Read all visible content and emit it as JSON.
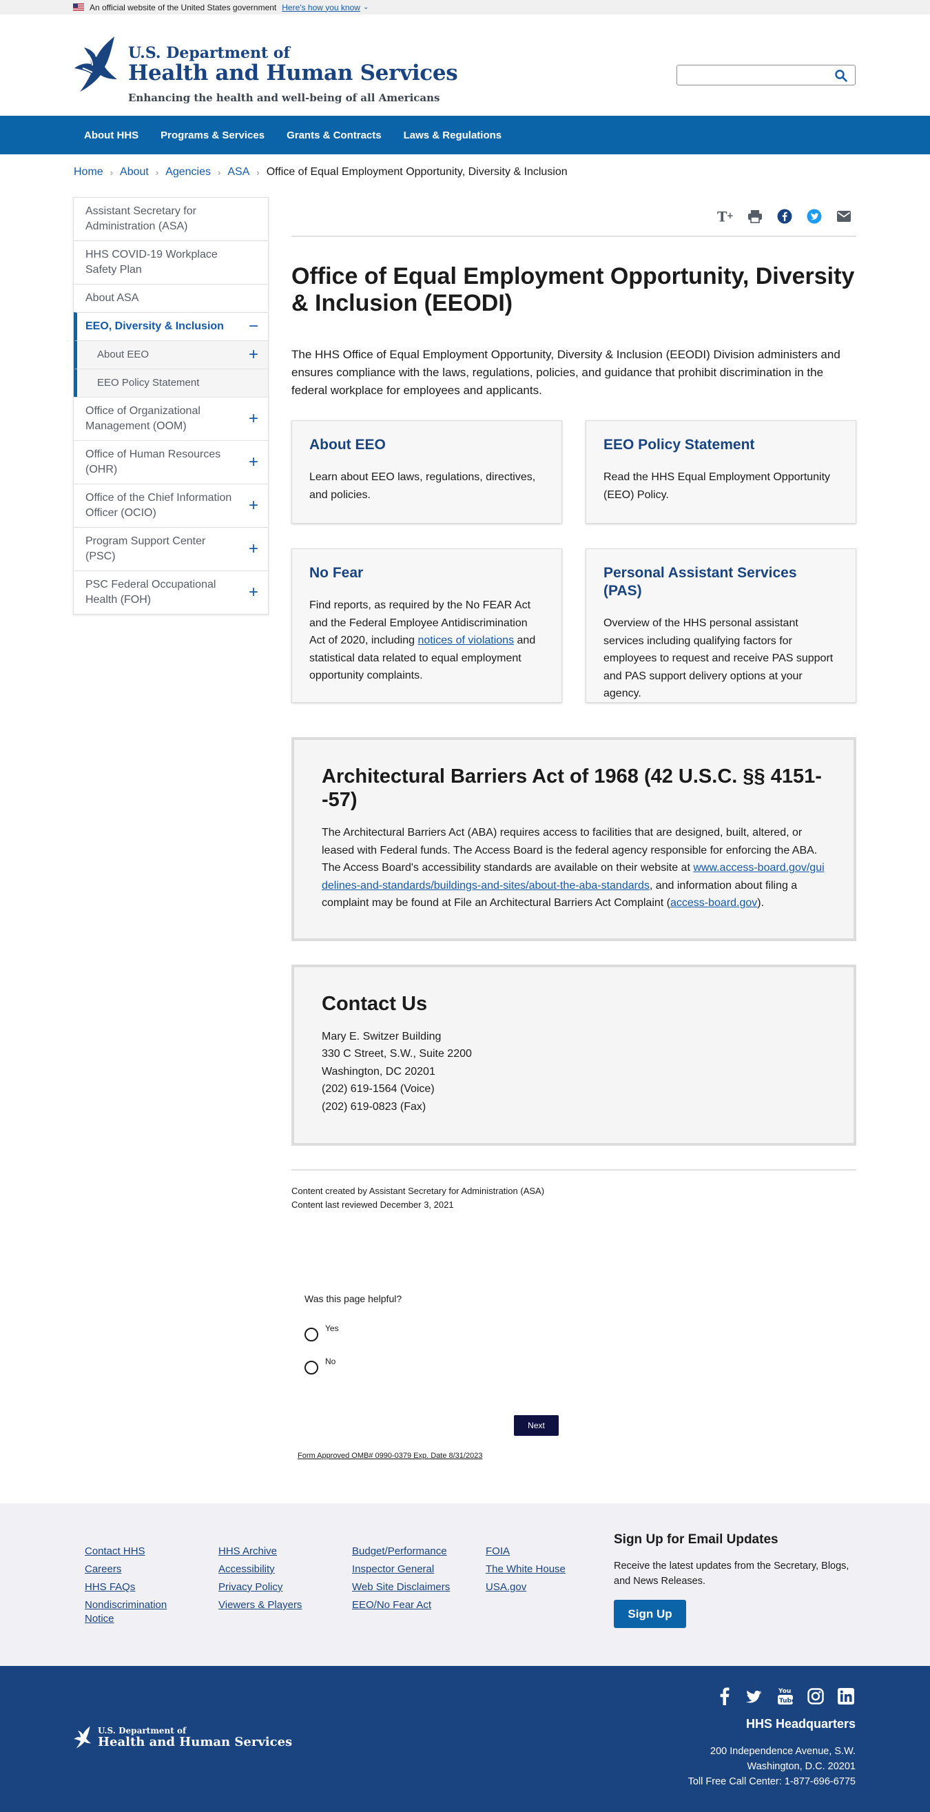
{
  "gov_banner": {
    "text": "An official website of the United States government",
    "link": "Here's how you know"
  },
  "header": {
    "logo_line1": "U.S. Department of",
    "logo_line2": "Health and Human Services",
    "tagline": "Enhancing the health and well-being of all Americans",
    "search_placeholder": ""
  },
  "nav": [
    "About HHS",
    "Programs & Services",
    "Grants & Contracts",
    "Laws & Regulations"
  ],
  "breadcrumb": [
    "Home",
    "About",
    "Agencies",
    "ASA"
  ],
  "breadcrumb_current": "Office of Equal Employment Opportunity, Diversity & Inclusion",
  "sidenav": [
    {
      "label": "Assistant Secretary for Administration (ASA)",
      "toggle": ""
    },
    {
      "label": "HHS COVID-19 Workplace Safety Plan",
      "toggle": ""
    },
    {
      "label": "About ASA",
      "toggle": ""
    },
    {
      "label": "EEO, Diversity & Inclusion",
      "toggle": "−"
    },
    {
      "label": "About EEO",
      "toggle": "+"
    },
    {
      "label": "EEO Policy Statement",
      "toggle": ""
    },
    {
      "label": "Office of Organizational Management (OOM)",
      "toggle": "+"
    },
    {
      "label": "Office of Human Resources (OHR)",
      "toggle": "+"
    },
    {
      "label": "Office of the Chief Information Officer (OCIO)",
      "toggle": "+"
    },
    {
      "label": "Program Support Center (PSC)",
      "toggle": "+"
    },
    {
      "label": "PSC Federal Occupational Health (FOH)",
      "toggle": "+"
    }
  ],
  "share_icons": [
    "text-resize-icon",
    "print-icon",
    "facebook-icon",
    "twitter-icon",
    "email-icon"
  ],
  "page_title": "Office of Equal Employment Opportunity, Diversity & Inclusion (EEODI)",
  "intro": "The HHS Office of Equal Employment Opportunity, Diversity & Inclusion (EEODI) Division administers and ensures compliance with the laws, regulations, policies, and guidance that prohibit discrimination in the federal workplace for employees and applicants.",
  "cards": [
    {
      "title": "About EEO",
      "text": "Learn about EEO laws, regulations, directives, and policies."
    },
    {
      "title": "EEO Policy Statement",
      "text": "Read the HHS Equal Employment Opportunity (EEO) Policy."
    },
    {
      "title": "No Fear",
      "text_before": "Find reports, as required by the No FEAR Act and the Federal Employee Antidiscrimination Act of 2020, including ",
      "link": "notices of violations",
      "text_after": " and statistical data related to equal employment opportunity complaints."
    },
    {
      "title": "Personal Assistant Services (PAS)",
      "text": "Overview of the HHS personal assistant services including qualifying factors for employees to request and receive PAS support and PAS support delivery options at your agency."
    }
  ],
  "aba": {
    "title": "Architectural Barriers Act of 1968 (42 U.S.C. §§ 4151- -57)",
    "text_before": "The Architectural Barriers Act (ABA) requires access to facilities that are designed, built, altered, or leased with Federal funds. The Access Board is the federal agency responsible for enforcing the ABA. The Access Board's accessibility standards are available on their website at ",
    "link1": "www.access-board.gov/guidelines-and-standards/buildings-and-sites/about-the-aba-standards",
    "text_mid": ", and information about filing a complaint may be found at File an Architectural Barriers Act Complaint (",
    "link2": "access-board.gov",
    "text_after": ")."
  },
  "contact": {
    "title": "Contact Us",
    "lines": [
      "Mary E. Switzer Building",
      "330 C Street, S.W., Suite 2200",
      "Washington, DC 20201",
      "(202) 619-1564 (Voice)",
      "(202) 619-0823 (Fax)"
    ]
  },
  "meta": {
    "created": "Content created by Assistant Secretary for Administration (ASA)",
    "reviewed": "Content last reviewed December 3, 2021"
  },
  "survey": {
    "question": "Was this page helpful?",
    "yes": "Yes",
    "no": "No",
    "next": "Next",
    "omb": "Form Approved OMB# 0990-0379 Exp. Date 8/31/2023"
  },
  "footer_links": [
    [
      "Contact HHS",
      "Careers",
      "HHS FAQs",
      "Nondiscrimination Notice"
    ],
    [
      "HHS Archive",
      "Accessibility",
      "Privacy Policy",
      "Viewers & Players"
    ],
    [
      "Budget/Performance",
      "Inspector General",
      "Web Site Disclaimers",
      "EEO/No Fear Act"
    ],
    [
      "FOIA",
      "The White House",
      "USA.gov"
    ]
  ],
  "signup": {
    "title": "Sign Up for Email Updates",
    "text": "Receive the latest updates from the Secretary, Blogs, and News Releases.",
    "button": "Sign Up"
  },
  "footer": {
    "logo_line1": "U.S. Department of",
    "logo_line2": "Health and Human Services",
    "socials": [
      "facebook-icon",
      "twitter-icon",
      "youtube-icon",
      "instagram-icon",
      "linkedin-icon"
    ],
    "hq_title": "HHS Headquarters",
    "hq_lines": [
      "200 Independence Avenue, S.W.",
      "Washington, D.C. 20201",
      "Toll Free Call Center: 1-877-696-6775"
    ]
  },
  "colors": {
    "primary": "#0b64a8",
    "navy": "#1a4480",
    "link": "#155aa8",
    "survey_button": "#0f1240"
  }
}
